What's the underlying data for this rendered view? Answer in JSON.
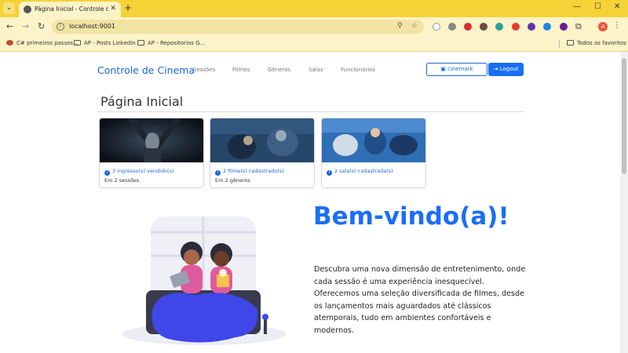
{
  "browser": {
    "tab_title": "Página Inicial - Controle de Cinema",
    "url": "localhost:9001",
    "bookmarks": [
      "C# primeiros passos...",
      "AP - Posts Linkedin",
      "AP - Repositorios G..."
    ],
    "all_bookmarks": "Todos os favoritos",
    "profile_initial": "A"
  },
  "navbar": {
    "brand": "Controle de Cinema",
    "links": [
      "Sessões",
      "Filmes",
      "Gêneros",
      "Salas",
      "Funcionários"
    ],
    "cinema_button": "cinemark",
    "logout_button": "Logout"
  },
  "page": {
    "title": "Página Inicial"
  },
  "cards": [
    {
      "line1": "3 ingresso(s) vendido(s)",
      "line2": "Em 2 sessões"
    },
    {
      "line1": "2 filme(s) cadastrado(s)",
      "line2": "Em 2 gêneros"
    },
    {
      "line1": "2 sala(s) cadastrada(s)",
      "line2": ""
    }
  ],
  "hero": {
    "title": "Bem-vindo(a)!",
    "text": "Descubra uma nova dimensão de entretenimento, onde cada sessão é uma experiência inesquecível. Oferecemos uma seleção diversificada de filmes, desde os lançamentos mais aguardados até clássicos atemporais, tudo em ambientes confortáveis e modernos."
  },
  "colors": {
    "chrome": "#f5d235",
    "primary": "#1a6ef5"
  }
}
